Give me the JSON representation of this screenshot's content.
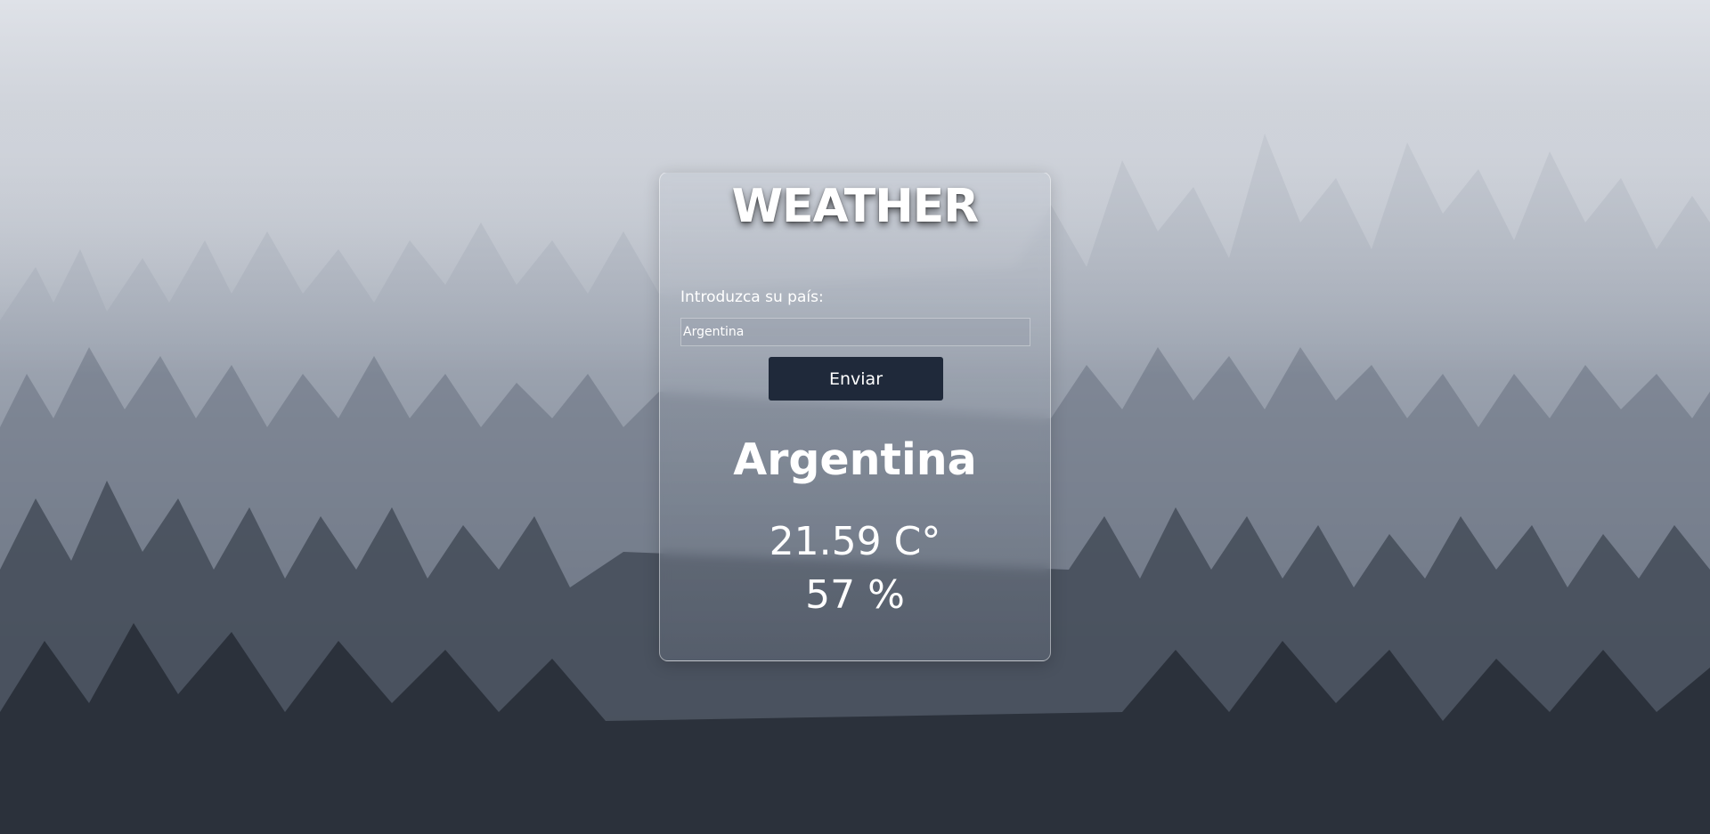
{
  "app": {
    "title": "WEATHER"
  },
  "form": {
    "label": "Introduzca su país:",
    "input_value": "Argentina",
    "submit_label": "Enviar"
  },
  "result": {
    "country": "Argentina",
    "temperature": "21.59 C°",
    "humidity": "57 %"
  },
  "colors": {
    "button_bg": "#1f293a",
    "text": "#ffffff"
  }
}
